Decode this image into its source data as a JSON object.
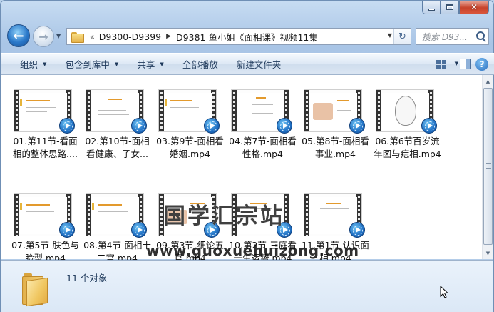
{
  "window": {
    "caption_buttons": [
      "minimize",
      "maximize",
      "close"
    ]
  },
  "nav": {
    "back_icon": "back-arrow-icon",
    "forward_icon": "forward-arrow-icon"
  },
  "address": {
    "overflow": "«",
    "crumbs": [
      "D9300-D9399",
      "D9381 鱼小姐《面相课》视频11集"
    ]
  },
  "search": {
    "placeholder": "搜索 D93..."
  },
  "toolbar": {
    "organize": "组织",
    "include_in_library": "包含到库中",
    "share": "共享",
    "play_all": "全部播放",
    "new_folder": "新建文件夹"
  },
  "files": [
    {
      "line1": "01.第11节-看面",
      "line2": "相的整体思路...."
    },
    {
      "line1": "02.第10节-面相",
      "line2": "看健康、子女..."
    },
    {
      "line1": "03.第9节-面相看",
      "line2": "婚姻.mp4"
    },
    {
      "line1": "04.第7节-面相看",
      "line2": "性格.mp4"
    },
    {
      "line1": "05.第8节-面相看",
      "line2": "事业.mp4"
    },
    {
      "line1": "06.第6节百岁流",
      "line2": "年图与痣相.mp4"
    },
    {
      "line1": "07.第5节-肤色与",
      "line2": "脸型.mp4"
    },
    {
      "line1": "08.第4节-面相十",
      "line2": "二宫.mp4"
    },
    {
      "line1": "09.第3节-细论五",
      "line2": "官.mp4"
    },
    {
      "line1": "10.第2节-三庭看",
      "line2": "一生运势.mp4"
    },
    {
      "line1": "11.第1节-认识面",
      "line2": "相.mp4"
    }
  ],
  "watermark": {
    "cn": "国学汇宗站",
    "url": "www.guoxuehuizong.com"
  },
  "details": {
    "count_text": "11 个对象"
  },
  "colors": {
    "accent": "#1e395b",
    "play_badge": "#1f6fc3",
    "slide_accent": "#e39a2d"
  }
}
